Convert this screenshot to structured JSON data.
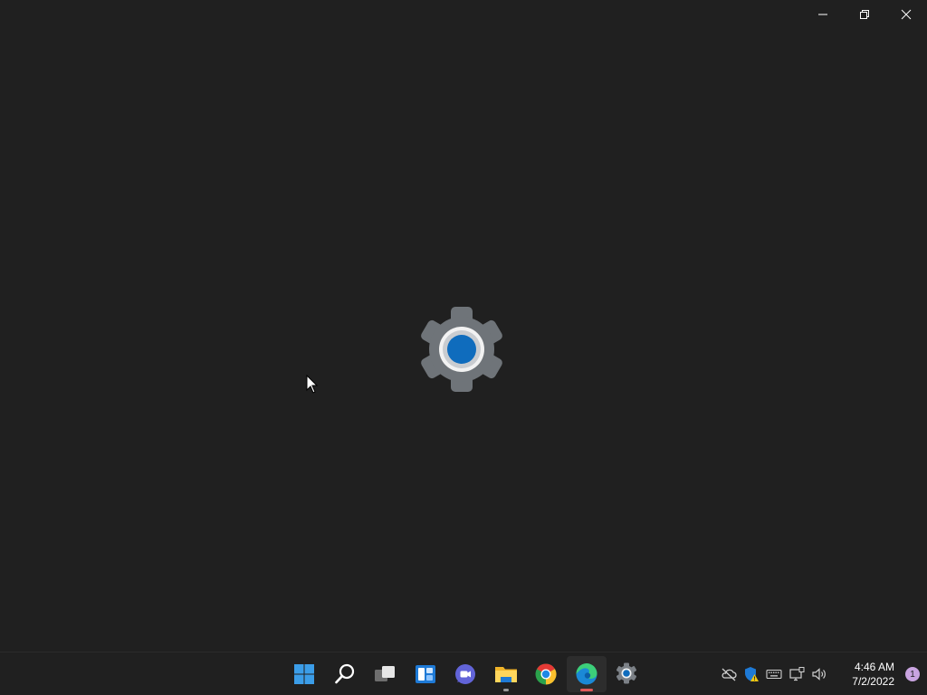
{
  "window": {
    "buttons": [
      "minimize",
      "restore",
      "close"
    ]
  },
  "splash": {
    "icon": "settings-gear-icon"
  },
  "taskbar": {
    "apps": [
      {
        "name": "start",
        "icon": "windows-logo-icon"
      },
      {
        "name": "search",
        "icon": "search-icon"
      },
      {
        "name": "task-view",
        "icon": "task-view-icon"
      },
      {
        "name": "widgets",
        "icon": "widgets-icon"
      },
      {
        "name": "teams-chat",
        "icon": "teams-chat-icon"
      },
      {
        "name": "file-explorer",
        "icon": "folder-icon",
        "running": true
      },
      {
        "name": "chrome",
        "icon": "chrome-icon"
      },
      {
        "name": "edge",
        "icon": "edge-icon",
        "running": true,
        "active": true
      },
      {
        "name": "settings",
        "icon": "gear-icon"
      }
    ],
    "tray": {
      "icons": [
        "onedrive-offline-icon",
        "security-warning-icon",
        "keyboard-icon",
        "network-icon",
        "volume-icon"
      ],
      "time": "4:46 AM",
      "date": "7/2/2022",
      "notification_count": "1"
    }
  },
  "colors": {
    "background": "#202020",
    "accent": "#0f6cbd"
  }
}
